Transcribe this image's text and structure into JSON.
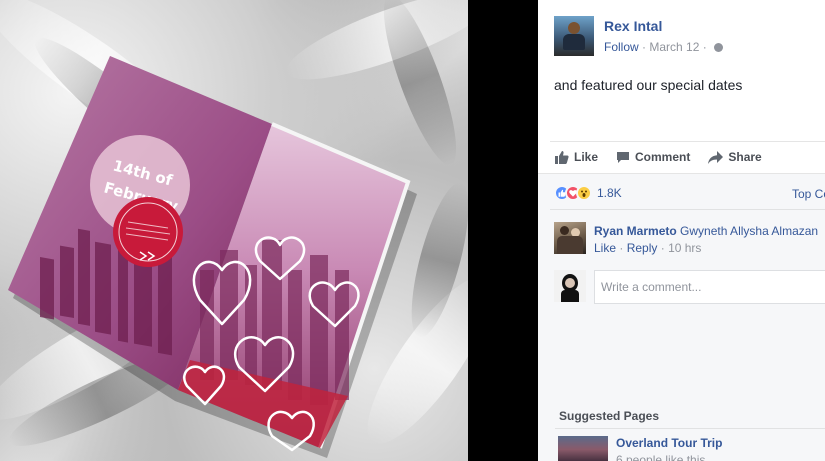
{
  "post": {
    "author": "Rex Intal",
    "follow": "Follow",
    "dot": "·",
    "date": "March 12",
    "text": "and featured our special dates"
  },
  "magazine": {
    "date_line1": "14th of",
    "date_line2": "February",
    "accent_color": "#c2185b"
  },
  "actions": {
    "like": "Like",
    "comment": "Comment",
    "share": "Share"
  },
  "reactions": {
    "icons": [
      "like-reaction-icon",
      "love-reaction-icon",
      "wow-reaction-icon"
    ],
    "count": "1.8K",
    "top_comments": "Top Comments"
  },
  "comments": [
    {
      "author": "Ryan Marmeto",
      "text": "Gwyneth Allysha Almazan",
      "like": "Like",
      "reply": "Reply",
      "sep": "·",
      "time": "10 hrs"
    }
  ],
  "comment_box": {
    "placeholder": "Write a comment..."
  },
  "suggested": {
    "title": "Suggested Pages",
    "pages": [
      {
        "name": "Overland Tour Trip",
        "likes": "6 people like this"
      }
    ]
  },
  "colors": {
    "link": "#365899",
    "muted": "#90949c",
    "like_blue": "#5890ff",
    "love_red": "#f25268",
    "wow_yellow": "#fbcd44"
  }
}
